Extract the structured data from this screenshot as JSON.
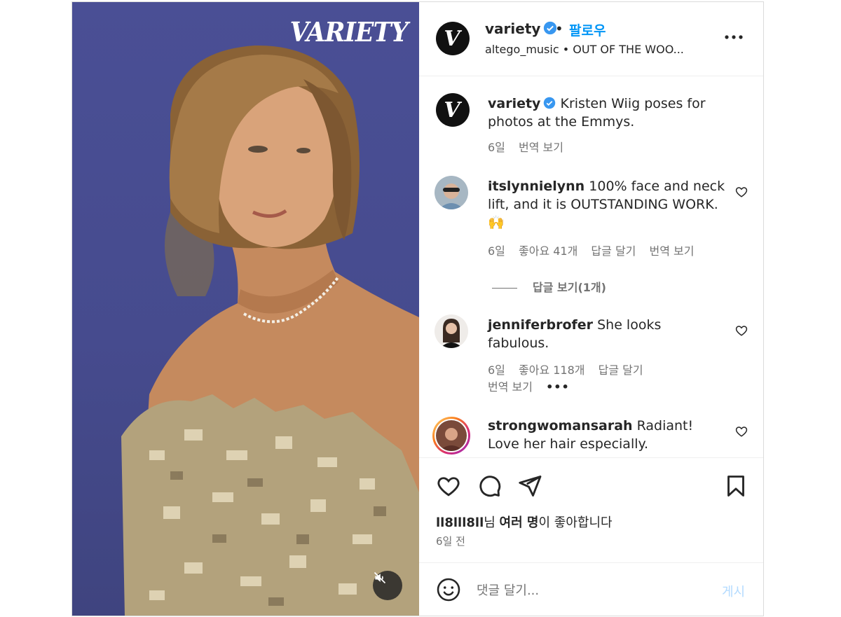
{
  "media": {
    "brand_logo": "VARIETY",
    "mute_icon": "speaker-muted-icon"
  },
  "header": {
    "username": "variety",
    "dot": "•",
    "follow_label": "팔로우",
    "subtitle": "altego_music • OUT OF THE WOO..."
  },
  "caption": {
    "username": "variety",
    "text": "Kristen Wiig poses for photos at the Emmys.",
    "time": "6일",
    "translate": "번역 보기"
  },
  "comments": [
    {
      "username": "itslynnielynn",
      "text": "100% face and neck lift, and it is OUTSTANDING WORK. 🙌",
      "time": "6일",
      "likes": "좋아요 41개",
      "reply": "답글 달기",
      "translate": "번역 보기",
      "view_replies": "답글 보기(1개)"
    },
    {
      "username": "jenniferbrofer",
      "text": "She looks fabulous.",
      "time": "6일",
      "likes": "좋아요 118개",
      "reply": "답글 달기",
      "translate": "번역 보기",
      "more": "•••"
    },
    {
      "username": "strongwomansarah",
      "text": "Radiant! Love her hair especially."
    }
  ],
  "actions": {
    "liked_by_user": "ll8lll8ll",
    "liked_by_suffix_1": "님 ",
    "liked_by_others": "여러 명",
    "liked_by_suffix_2": "이 좋아합니다",
    "time": "6일 전"
  },
  "composer": {
    "placeholder": "댓글 달기...",
    "post_label": "게시"
  },
  "colors": {
    "accent": "#0095f6",
    "verified": "#3897f0",
    "post_disabled": "#b3dbff",
    "muted_text": "#737373"
  }
}
